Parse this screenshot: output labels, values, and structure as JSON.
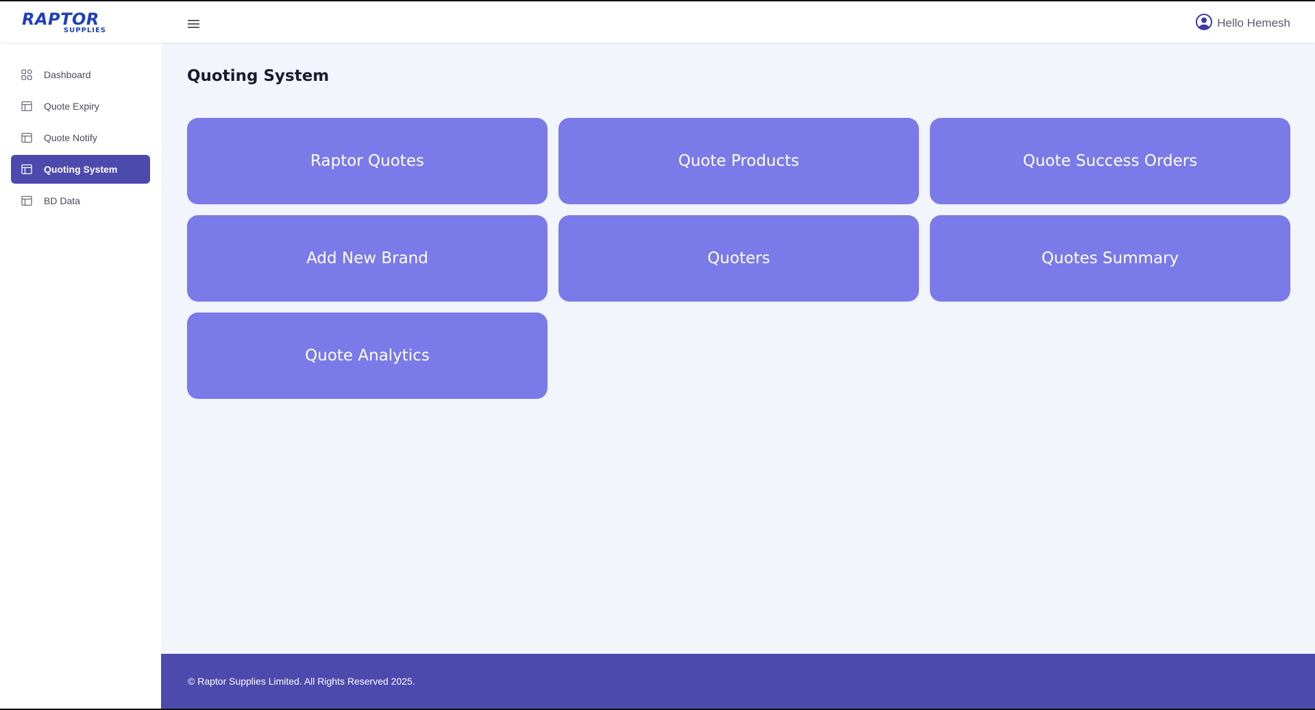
{
  "brand": {
    "name": "RAPTOR",
    "sub": "SUPPLIES",
    "color": "#1f3fbf"
  },
  "header": {
    "menu_icon": "hamburger-icon",
    "user_icon": "user-circle-icon",
    "greeting": "Hello Hemesh"
  },
  "sidebar": {
    "items": [
      {
        "label": "Dashboard",
        "icon": "grid-icon",
        "active": false
      },
      {
        "label": "Quote Expiry",
        "icon": "table-icon",
        "active": false
      },
      {
        "label": "Quote Notify",
        "icon": "table-icon",
        "active": false
      },
      {
        "label": "Quoting System",
        "icon": "table-icon",
        "active": true
      },
      {
        "label": "BD Data",
        "icon": "table-icon",
        "active": false
      }
    ]
  },
  "main": {
    "title": "Quoting System",
    "cards": [
      {
        "label": "Raptor Quotes"
      },
      {
        "label": "Quote Products"
      },
      {
        "label": "Quote Success Orders"
      },
      {
        "label": "Add New Brand"
      },
      {
        "label": "Quoters"
      },
      {
        "label": "Quotes Summary"
      },
      {
        "label": "Quote Analytics"
      }
    ]
  },
  "footer": {
    "text": "© Raptor Supplies Limited. All Rights Reserved 2025."
  },
  "colors": {
    "accent": "#4d4aae",
    "card": "#7a7ae8",
    "background": "#f2f5fc"
  }
}
